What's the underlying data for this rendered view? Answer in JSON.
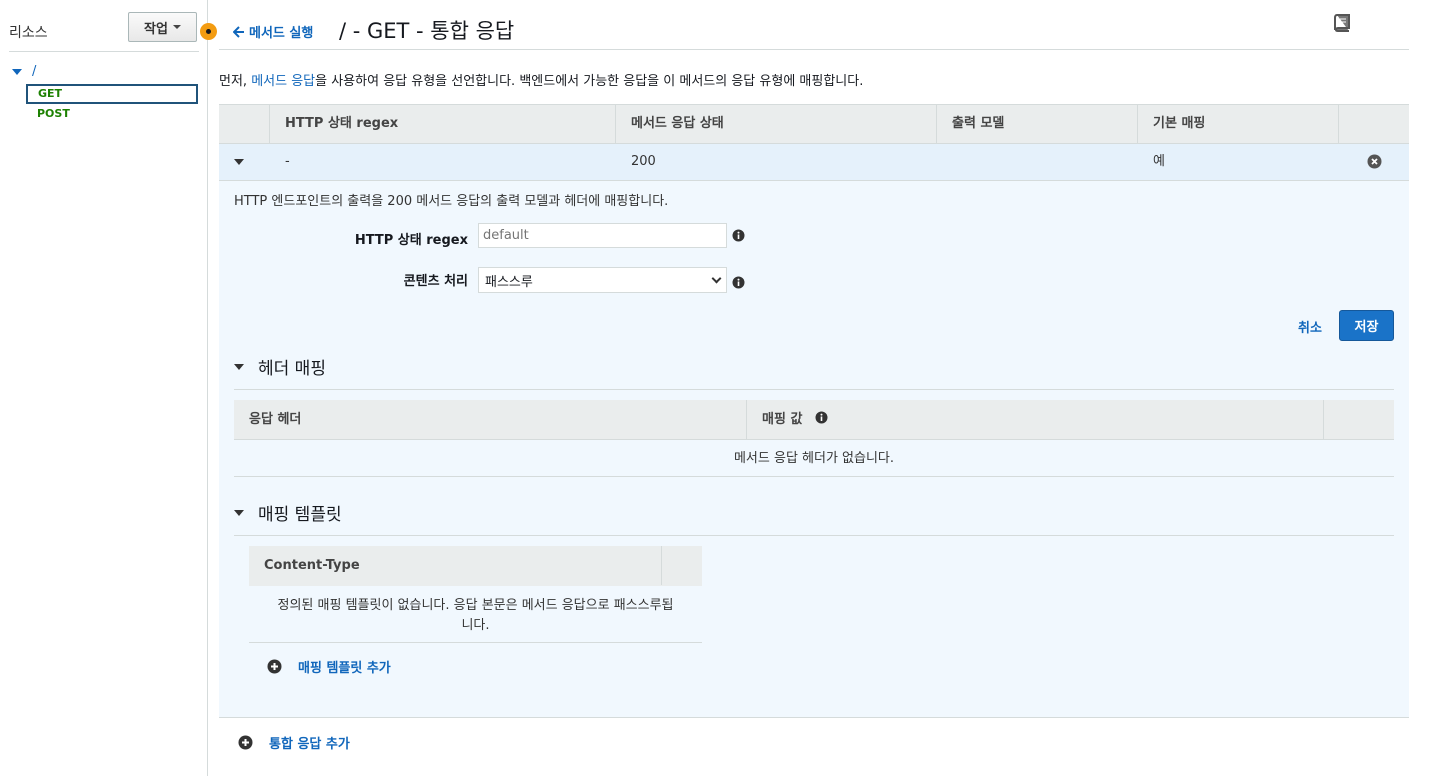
{
  "sidebar": {
    "title": "리소스",
    "action_label": "작업",
    "tree": {
      "root": "/",
      "methods": [
        "GET",
        "POST"
      ]
    }
  },
  "header": {
    "back_label": "메서드 실행",
    "title": "/ - GET - 통합 응답"
  },
  "intro": {
    "prefix": "먼저, ",
    "link": "메서드 응답",
    "suffix": "을 사용하여 응답 유형을 선언합니다. 백엔드에서 가능한 응답을 이 메서드의 응답 유형에 매핑합니다."
  },
  "table": {
    "columns": [
      "HTTP 상태 regex",
      "메서드 응답 상태",
      "출력 모델",
      "기본 매핑"
    ],
    "row": {
      "regex": "-",
      "status": "200",
      "model": "",
      "default": "예"
    }
  },
  "detail": {
    "description": "HTTP 엔드포인트의 출력을 200 메서드 응답의 출력 모델과 헤더에 매핑합니다.",
    "regex_label": "HTTP 상태 regex",
    "regex_placeholder": "default",
    "content_label": "콘텐츠 처리",
    "content_value": "패스스루",
    "cancel_label": "취소",
    "save_label": "저장"
  },
  "header_mapping": {
    "title": "헤더 매핑",
    "columns": [
      "응답 헤더",
      "매핑 값"
    ],
    "empty": "메서드 응답 헤더가 없습니다."
  },
  "templates": {
    "title": "매핑 템플릿",
    "column": "Content-Type",
    "empty_line1": "정의된 매핑 템플릿이 없습니다. 응답 본문은 메서드 응답으로 패스스루됩",
    "empty_line2": "니다.",
    "add_label": "매핑 템플릿 추가"
  },
  "footer": {
    "add_label": "통합 응답 추가"
  },
  "colors": {
    "link": "#1066bb",
    "method": "#1d8102",
    "accent": "#f39c12",
    "primary": "#1a73c8"
  }
}
